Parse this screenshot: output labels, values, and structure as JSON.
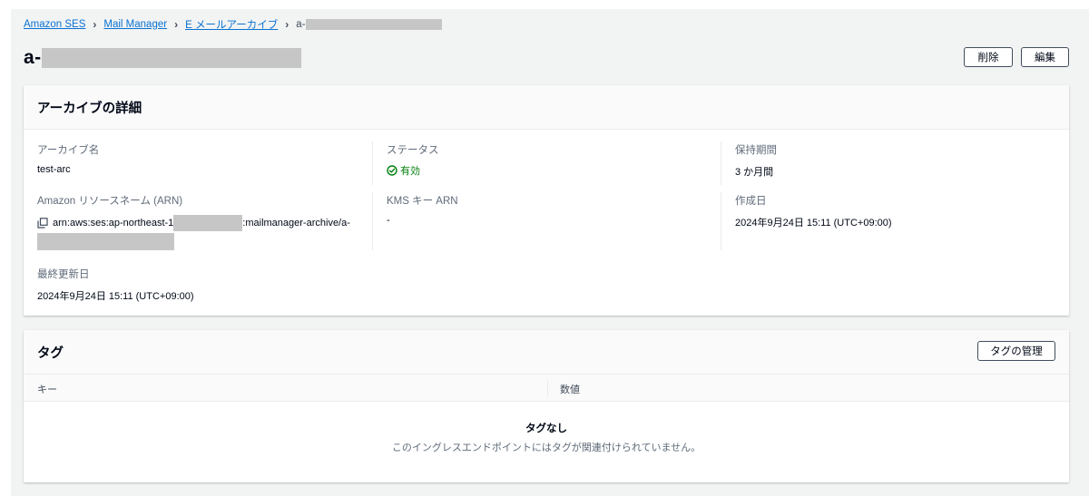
{
  "breadcrumb": {
    "items": [
      "Amazon SES",
      "Mail Manager",
      "E メールアーカイブ"
    ],
    "current_prefix": "a-"
  },
  "header": {
    "title_prefix": "a-",
    "delete_label": "削除",
    "edit_label": "編集"
  },
  "details": {
    "title": "アーカイブの詳細",
    "archive_name_label": "アーカイブ名",
    "archive_name_value": "test-arc",
    "status_label": "ステータス",
    "status_value": "有効",
    "retention_label": "保持期間",
    "retention_value": "3 か月間",
    "arn_label": "Amazon リソースネーム (ARN)",
    "arn_prefix": "arn:aws:ses:ap-northeast-1",
    "arn_suffix": ":mailmanager-archive/a-",
    "kms_label": "KMS キー ARN",
    "kms_value": "-",
    "created_label": "作成日",
    "created_value": "2024年9月24日 15:11 (UTC+09:00)",
    "updated_label": "最終更新日",
    "updated_value": "2024年9月24日 15:11 (UTC+09:00)"
  },
  "tags": {
    "title": "タグ",
    "manage_label": "タグの管理",
    "columns": [
      "キー",
      "数値"
    ],
    "empty_title": "タグなし",
    "empty_message": "このイングレスエンドポイントにはタグが関連付けられていません。"
  },
  "colors": {
    "link": "#0972d3",
    "success": "#037f0c",
    "redaction": "#c6c6c6"
  },
  "icons": {
    "copy": "copy-icon",
    "status": "check-circle-icon",
    "breadcrumb_separator": "chevron-right-icon"
  }
}
